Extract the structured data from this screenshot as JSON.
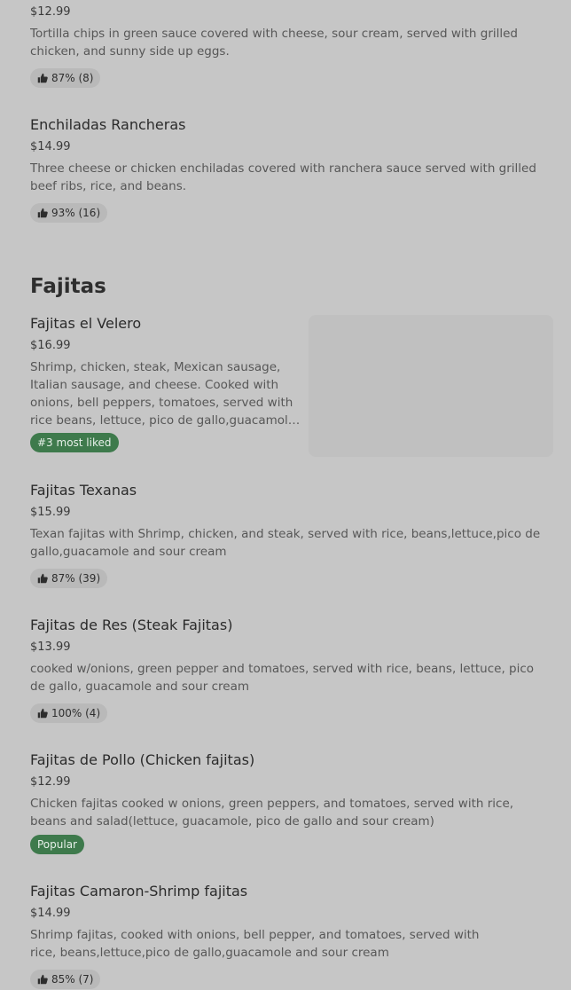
{
  "top_item": {
    "price": "$12.99",
    "description": "Tortilla chips in green sauce covered with cheese, sour cream, served with grilled chicken, and sunny side up eggs.",
    "rating": "87% (8)"
  },
  "enchiladas_rancheras": {
    "name": "Enchiladas Rancheras",
    "price": "$14.99",
    "description": "Three cheese or chicken enchiladas covered with ranchera sauce served with grilled beef ribs, rice, and beans.",
    "rating": "93% (16)"
  },
  "section": {
    "title": "Fajitas"
  },
  "fajitas_el_velero": {
    "name": "Fajitas el Velero",
    "price": "$16.99",
    "description": "Shrimp, chicken, steak, Mexican sausage, Italian sausage, and cheese. Cooked with onions, bell peppers, tomatoes, served with rice beans, lettuce, pico de gallo,guacamole and sour cream",
    "badge": "#3 most liked"
  },
  "fajitas_texanas": {
    "name": "Fajitas Texanas",
    "price": "$15.99",
    "description": "Texan fajitas with Shrimp, chicken, and steak, served with rice, beans,lettuce,pico de gallo,guacamole and sour cream",
    "rating": "87% (39)"
  },
  "fajitas_de_res": {
    "name": "Fajitas de Res (Steak Fajitas)",
    "price": "$13.99",
    "description": "cooked w/onions, green pepper and tomatoes, served with rice, beans, lettuce, pico de gallo, guacamole and sour cream",
    "rating": "100% (4)"
  },
  "fajitas_de_pollo": {
    "name": "Fajitas de Pollo (Chicken fajitas)",
    "price": "$12.99",
    "description": "Chicken fajitas cooked w onions, green peppers, and tomatoes, served with rice, beans and salad(lettuce, guacamole, pico de gallo and sour cream)",
    "badge": "Popular"
  },
  "fajitas_camaron": {
    "name": "Fajitas Camaron-Shrimp fajitas",
    "price": "$14.99",
    "description": "Shrimp fajitas, cooked with onions, bell pepper, and tomatoes, served with rice, beans,lettuce,pico de gallo,guacamole and sour cream",
    "rating": "85% (7)"
  },
  "icons": {
    "rating": "thumbs-up-icon"
  },
  "colors": {
    "page_background": "#c6c6c6",
    "badge_background": "#3e7a4c",
    "rating_pill_background": "#b9b9b9"
  }
}
